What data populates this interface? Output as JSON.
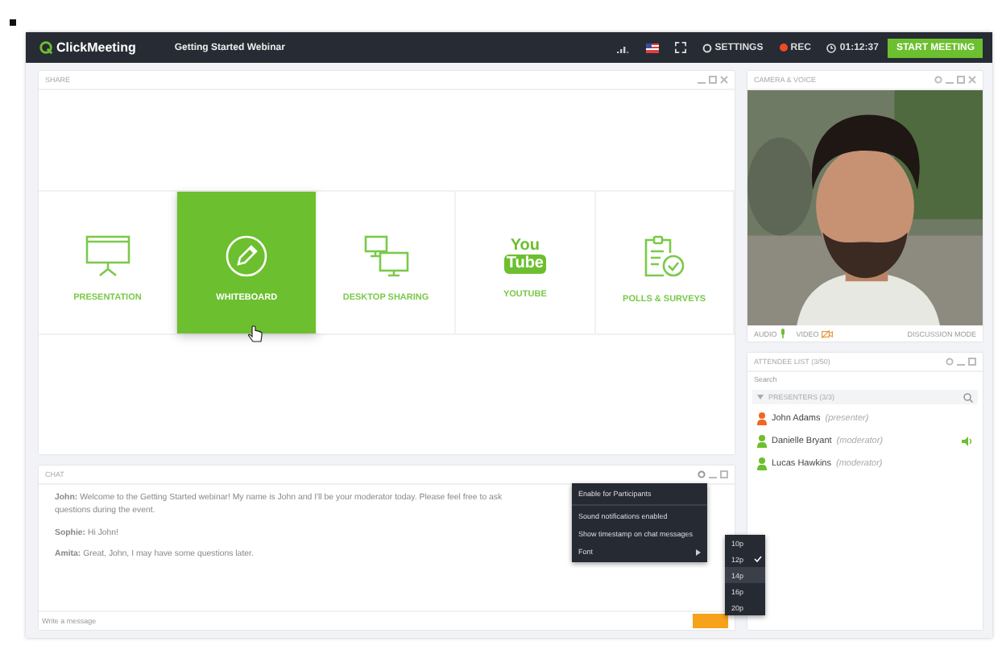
{
  "topbar": {
    "logo": "ClickMeeting",
    "title": "Getting Started Webinar",
    "settings": "SETTINGS",
    "rec": "REC",
    "time": "01:12:37",
    "start_button": "START MEETING"
  },
  "share": {
    "title": "SHARE",
    "tiles": [
      {
        "kind": "presentation",
        "label": "PRESENTATION",
        "selected": false
      },
      {
        "kind": "whiteboard",
        "label": "WHITEBOARD",
        "selected": true
      },
      {
        "kind": "desktop",
        "label": "DESKTOP SHARING",
        "selected": false
      },
      {
        "kind": "video",
        "label": "YOUTUBE",
        "logo_text": [
          "You",
          "Tube"
        ],
        "selected": false
      },
      {
        "kind": "polls",
        "label": "POLLS & SURVEYS",
        "selected": false
      }
    ]
  },
  "camera": {
    "title": "CAMERA & VOICE",
    "audio": "AUDIO",
    "video": "VIDEO",
    "mode": "DISCUSSION MODE"
  },
  "attendees": {
    "title": "ATTENDEE LIST (3/50)",
    "search_placeholder": "Search",
    "group": "PRESENTERS (3/3)",
    "people": [
      {
        "name": "John Adams",
        "role": "(presenter)",
        "color": "#f26522",
        "speaking": false
      },
      {
        "name": "Danielle Bryant",
        "role": "(moderator)",
        "color": "#6cbf2e",
        "speaking": true
      },
      {
        "name": "Lucas Hawkins",
        "role": "(moderator)",
        "color": "#6cbf2e",
        "speaking": false
      }
    ]
  },
  "chat": {
    "title": "CHAT",
    "messages": [
      "**John:** Welcome to the Getting Started webinar! My name is John and I'll be your moderator today. Please feel free to ask questions during the event.",
      "**Sophie:** Hi John!",
      "**Amita:** Great, John, I may have some questions later."
    ],
    "placeholder": "Write a message",
    "menu": [
      {
        "label": "Enable for Participants",
        "submenu": false
      },
      {
        "label": "Sound notifications enabled",
        "submenu": false
      },
      {
        "label": "Show timestamp on chat messages",
        "submenu": false
      },
      {
        "label": "Font",
        "submenu": true
      }
    ],
    "font_sizes": [
      {
        "label": "10p",
        "selected": false,
        "hovered": false
      },
      {
        "label": "12p",
        "selected": true,
        "hovered": false
      },
      {
        "label": "14p",
        "selected": false,
        "hovered": true
      },
      {
        "label": "16p",
        "selected": false,
        "hovered": false
      },
      {
        "label": "20p",
        "selected": false,
        "hovered": false
      }
    ]
  }
}
